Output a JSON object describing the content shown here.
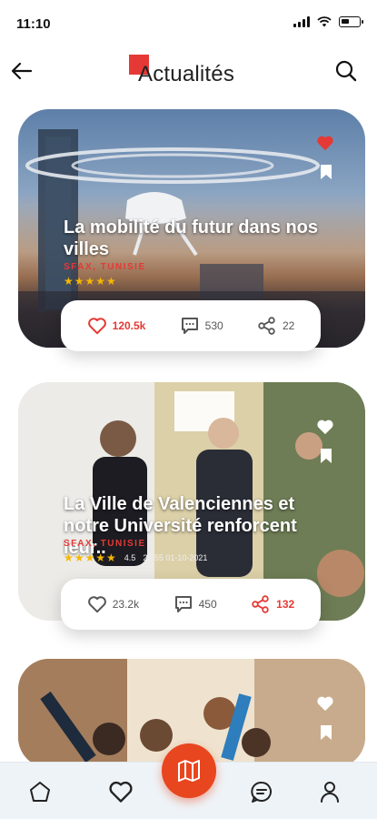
{
  "status_bar": {
    "time": "11:10"
  },
  "header": {
    "title": "Actualités",
    "back_icon": "arrow-left-icon",
    "search_icon": "search-icon"
  },
  "colors": {
    "accent": "#e53935",
    "fab": "#e8461f",
    "nav_bg": "#eef3f7"
  },
  "articles": [
    {
      "title": "La mobilité du futur dans nos villes",
      "location": "SFAX, TUNISIE",
      "rating_stars": "★★★★★",
      "rating": "",
      "date": "",
      "likes": "120.5k",
      "comments": "530",
      "shares": "22",
      "liked": true
    },
    {
      "title": "La Ville de Valenciennes et notre Université renforcent leur..",
      "location": "SFAX, TUNISIE",
      "rating_stars": "★★★★★",
      "rating": "4.5",
      "date": "23:55 01-10-2021",
      "likes": "23.2k",
      "comments": "450",
      "shares": "132",
      "shared": true
    },
    {
      "title": "",
      "location": ""
    }
  ],
  "bottom_nav": {
    "items": [
      "home-icon",
      "heart-icon",
      "map-icon",
      "chat-icon",
      "profile-icon"
    ]
  }
}
